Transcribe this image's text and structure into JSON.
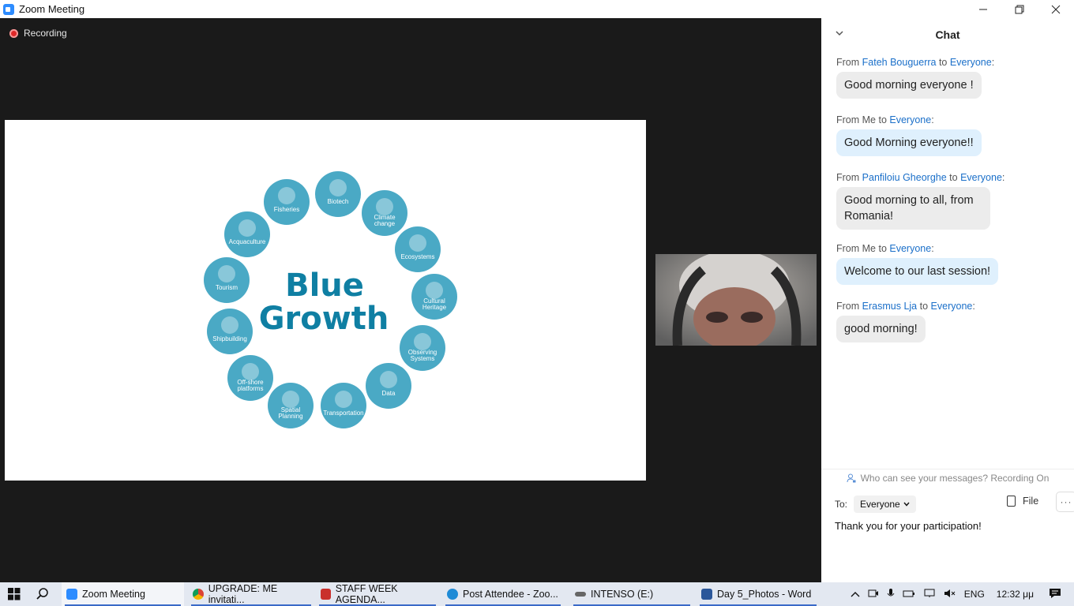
{
  "window": {
    "title": "Zoom Meeting"
  },
  "meeting": {
    "recording_label": "Recording",
    "slide": {
      "title_line1": "Blue",
      "title_line2": "Growth",
      "sectors": [
        "Fisheries",
        "Biotech",
        "Climate change",
        "Ecosystems",
        "Cultural Heritage",
        "Observing Systems",
        "Data",
        "Transportation",
        "Spatial Planning",
        "Off-shore platforms",
        "Shipbuilding",
        "Tourism",
        "Acquaculture"
      ]
    }
  },
  "chat": {
    "title": "Chat",
    "messages": [
      {
        "prefix": "From",
        "sender": "Fateh Bouguerra",
        "mid": "to",
        "recipient": "Everyone",
        "suffix": ":",
        "text": "Good morning everyone !",
        "mine": false
      },
      {
        "prefix": "From Me to",
        "sender": "",
        "mid": "",
        "recipient": "Everyone",
        "suffix": ":",
        "text": "Good Morning everyone!!",
        "mine": true
      },
      {
        "prefix": "From",
        "sender": "Panfiloiu Gheorghe",
        "mid": "to",
        "recipient": "Everyone",
        "suffix": ":",
        "text": "Good morning to all, from Romania!",
        "mine": false
      },
      {
        "prefix": "From Me to",
        "sender": "",
        "mid": "",
        "recipient": "Everyone",
        "suffix": ":",
        "text": "Welcome to our last session!",
        "mine": true
      },
      {
        "prefix": "From",
        "sender": "Erasmus Lja",
        "mid": "to",
        "recipient": "Everyone",
        "suffix": ":",
        "text": "good morning!",
        "mine": false
      }
    ],
    "privacy_text": "Who can see your messages? Recording On",
    "to_label": "To:",
    "to_value": "Everyone",
    "file_label": "File",
    "more_label": "···",
    "input_value": "Thank you for your participation!"
  },
  "taskbar": {
    "items": [
      {
        "label": "Zoom Meeting",
        "active": true
      },
      {
        "label": "UPGRADE: ME invitati...",
        "active": false
      },
      {
        "label": "STAFF WEEK AGENDA...",
        "active": false
      },
      {
        "label": "Post Attendee - Zoo...",
        "active": false
      },
      {
        "label": "INTENSO (E:)",
        "active": false
      },
      {
        "label": "Day 5_Photos - Word",
        "active": false
      }
    ],
    "language": "ENG",
    "clock": "12:32 μμ"
  },
  "colors": {
    "zoom_blue": "#2d8cff",
    "circle_blue": "#4aa9c5",
    "slide_text": "#0f7fa3",
    "link_blue": "#1a6fc9",
    "record_red": "#e02828"
  }
}
